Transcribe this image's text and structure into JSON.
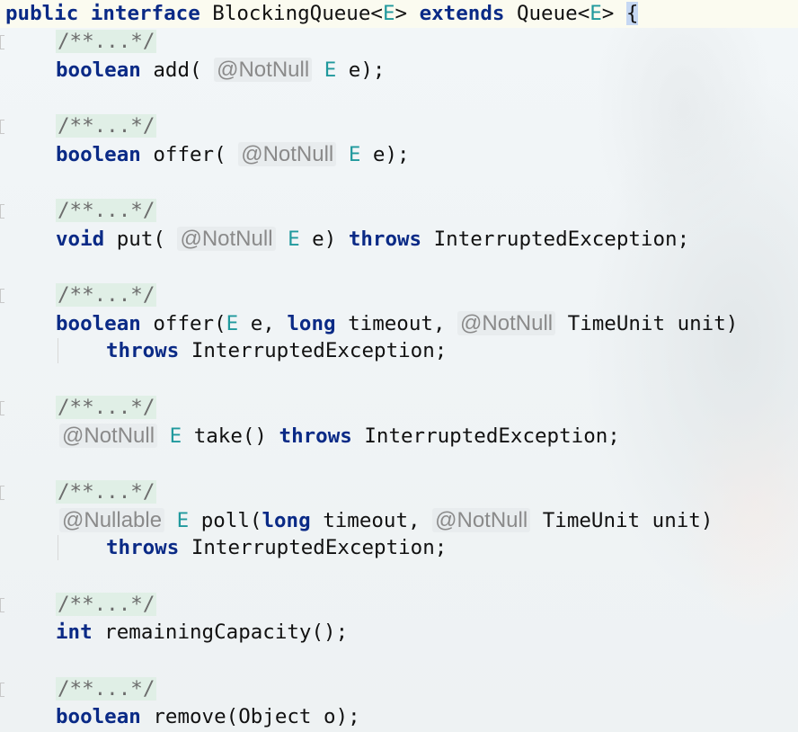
{
  "code": {
    "header": {
      "kw_public": "public",
      "kw_interface": "interface",
      "name": "BlockingQueue<",
      "tp1": "E",
      "after1": "> ",
      "kw_extends": "extends",
      "parent": " Queue<",
      "tp2": "E",
      "after2": "> ",
      "brace": "{"
    },
    "fold_label": "/**...*/",
    "ann_notnull": "@NotNull",
    "ann_nullable": "@Nullable",
    "kw_boolean": "boolean",
    "kw_void": "void",
    "kw_long": "long",
    "kw_throws": "throws",
    "kw_int": "int",
    "type_e": "E",
    "m_add_name": " add(",
    "m_add_tail": " e);",
    "m_offer_name": " offer(",
    "m_offer_tail": " e);",
    "m_put_name": " put(",
    "m_put_mid": " e) ",
    "exc_tail": " InterruptedException;",
    "m_offer2_name": " offer(",
    "m_offer2_mid1": " e, ",
    "m_offer2_mid2": " timeout, ",
    "m_offer2_tail": " TimeUnit unit)",
    "m_take_mid": " take() ",
    "m_poll_mid1": " poll(",
    "m_poll_mid2": " timeout, ",
    "m_poll_tail": " TimeUnit unit)",
    "m_remaining": " remainingCapacity();",
    "m_remove": " remove(Object o);"
  }
}
